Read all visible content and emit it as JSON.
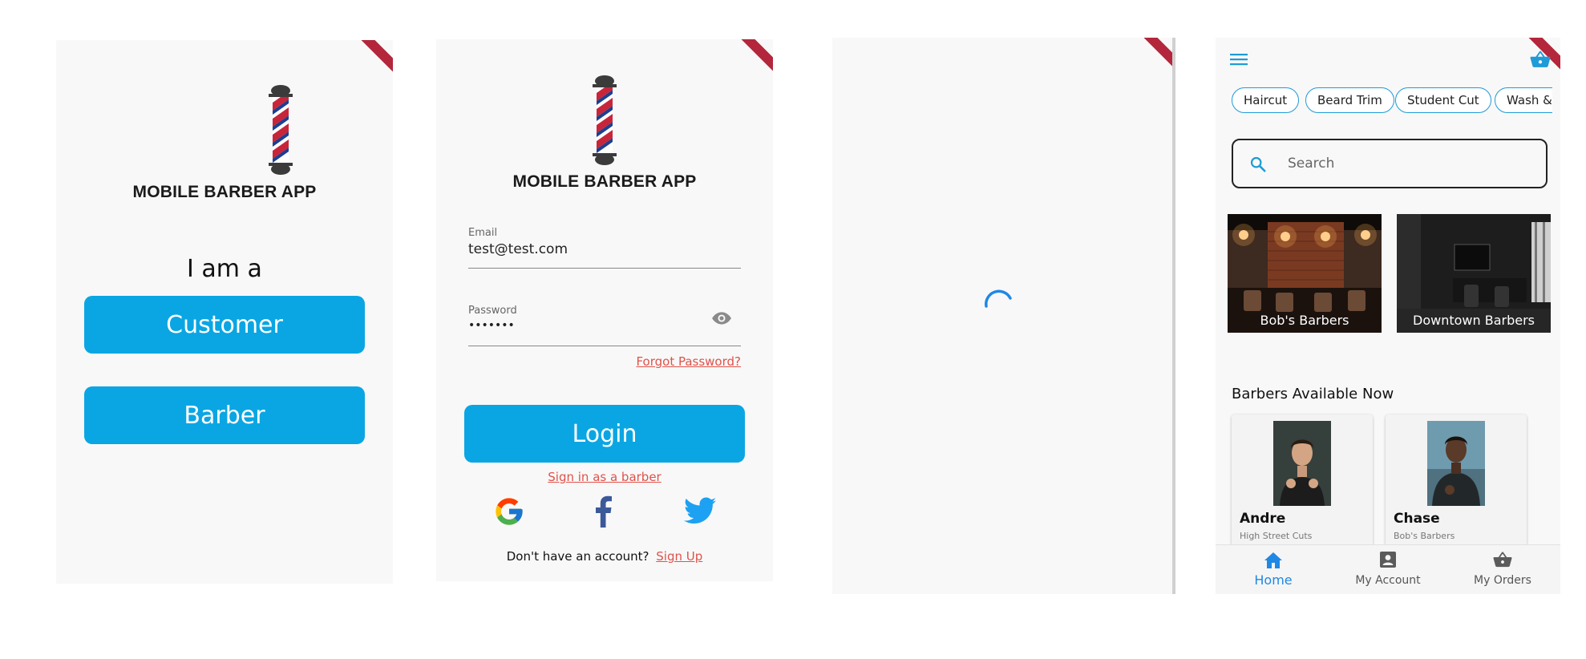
{
  "screen1": {
    "app_name": "MOBILE BARBER APP",
    "prompt": "I am a",
    "customer_button": "Customer",
    "barber_button": "Barber"
  },
  "screen2": {
    "app_name": "MOBILE BARBER APP",
    "email_label": "Email",
    "email_value": "test@test.com",
    "password_label": "Password",
    "password_value": "•••••••",
    "forgot_password": "Forgot Password?",
    "login_button": "Login",
    "barber_link": "Sign in as a barber",
    "signup_prompt": "Don't have an account?",
    "signup_link": "Sign Up"
  },
  "screen3": {
    "spinner": "loading"
  },
  "screen4": {
    "categories": [
      "Haircut",
      "Beard Trim",
      "Student Cut",
      "Wash &"
    ],
    "search_placeholder": "Search",
    "shops": [
      {
        "name": "Bob's Barbers"
      },
      {
        "name": "Downtown Barbers"
      }
    ],
    "section_title": "Barbers Available Now",
    "barbers": [
      {
        "name": "Andre",
        "shop": "High Street Cuts"
      },
      {
        "name": "Chase",
        "shop": "Bob's Barbers"
      }
    ],
    "nav": [
      {
        "label": "Home",
        "icon": "home-icon",
        "active": true
      },
      {
        "label": "My Account",
        "icon": "account-box-icon",
        "active": false
      },
      {
        "label": "My Orders",
        "icon": "basket-icon",
        "active": false
      }
    ]
  },
  "colors": {
    "primary_blue": "#0aa6e3",
    "link_red": "#e0524a",
    "accent_blue": "#1f9bd7",
    "debug_red": "#b3263b"
  }
}
